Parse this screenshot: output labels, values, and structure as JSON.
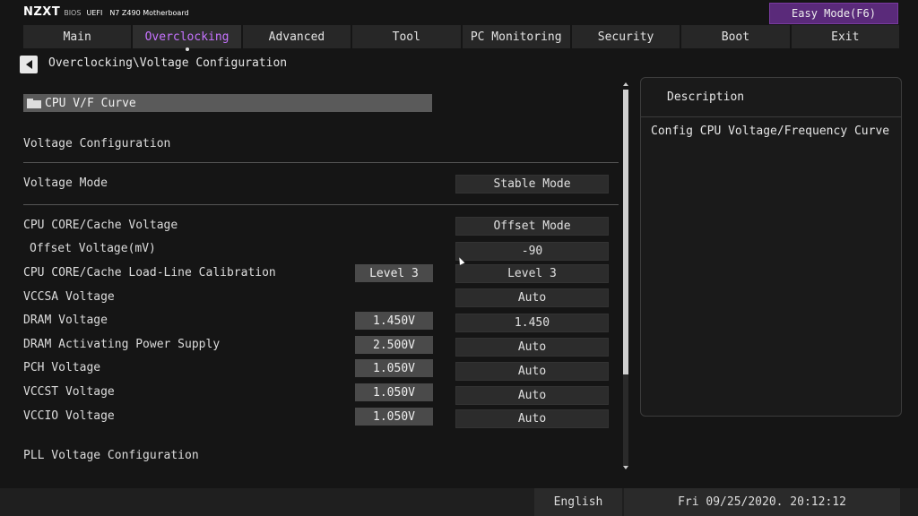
{
  "header": {
    "logo": "NZXT",
    "bios": "BIOS",
    "uefi": "UEFI",
    "model": "N7 Z490 Motherboard",
    "easy_mode_label": "Easy Mode(F6)"
  },
  "tabs": [
    {
      "label": "Main"
    },
    {
      "label": "Overclocking",
      "active": true
    },
    {
      "label": "Advanced"
    },
    {
      "label": "Tool"
    },
    {
      "label": "PC Monitoring"
    },
    {
      "label": "Security"
    },
    {
      "label": "Boot"
    },
    {
      "label": "Exit"
    }
  ],
  "breadcrumb": "Overclocking\\Voltage Configuration",
  "main": {
    "curve_item": "CPU V/F Curve",
    "section_voltage_config": "Voltage Configuration",
    "section_pll": "PLL Voltage Configuration",
    "rows": {
      "voltage_mode": {
        "label": "Voltage Mode",
        "value": "Stable Mode"
      },
      "cpu_core_cache_voltage": {
        "label": "CPU CORE/Cache Voltage",
        "value": "Offset Mode"
      },
      "offset_voltage": {
        "label": "Offset Voltage(mV)",
        "value": "-90"
      },
      "llc": {
        "label": "CPU CORE/Cache Load-Line Calibration",
        "current": "Level 3",
        "value": "Level 3"
      },
      "vccsa": {
        "label": "VCCSA Voltage",
        "value": "Auto"
      },
      "dram": {
        "label": "DRAM Voltage",
        "current": "1.450V",
        "value": "1.450"
      },
      "dram_activating": {
        "label": "DRAM Activating Power Supply",
        "current": "2.500V",
        "value": "Auto"
      },
      "pch": {
        "label": "PCH Voltage",
        "current": "1.050V",
        "value": "Auto"
      },
      "vccst": {
        "label": "VCCST Voltage",
        "current": "1.050V",
        "value": "Auto"
      },
      "vccio": {
        "label": "VCCIO Voltage",
        "current": "1.050V",
        "value": "Auto"
      }
    }
  },
  "description": {
    "title": "Description",
    "text": "Config CPU Voltage/Frequency Curve"
  },
  "footer": {
    "language": "English",
    "datetime": "Fri 09/25/2020. 20:12:12"
  },
  "colors": {
    "accent": "#c673ff",
    "easy_mode_bg": "#5a2a7a"
  }
}
